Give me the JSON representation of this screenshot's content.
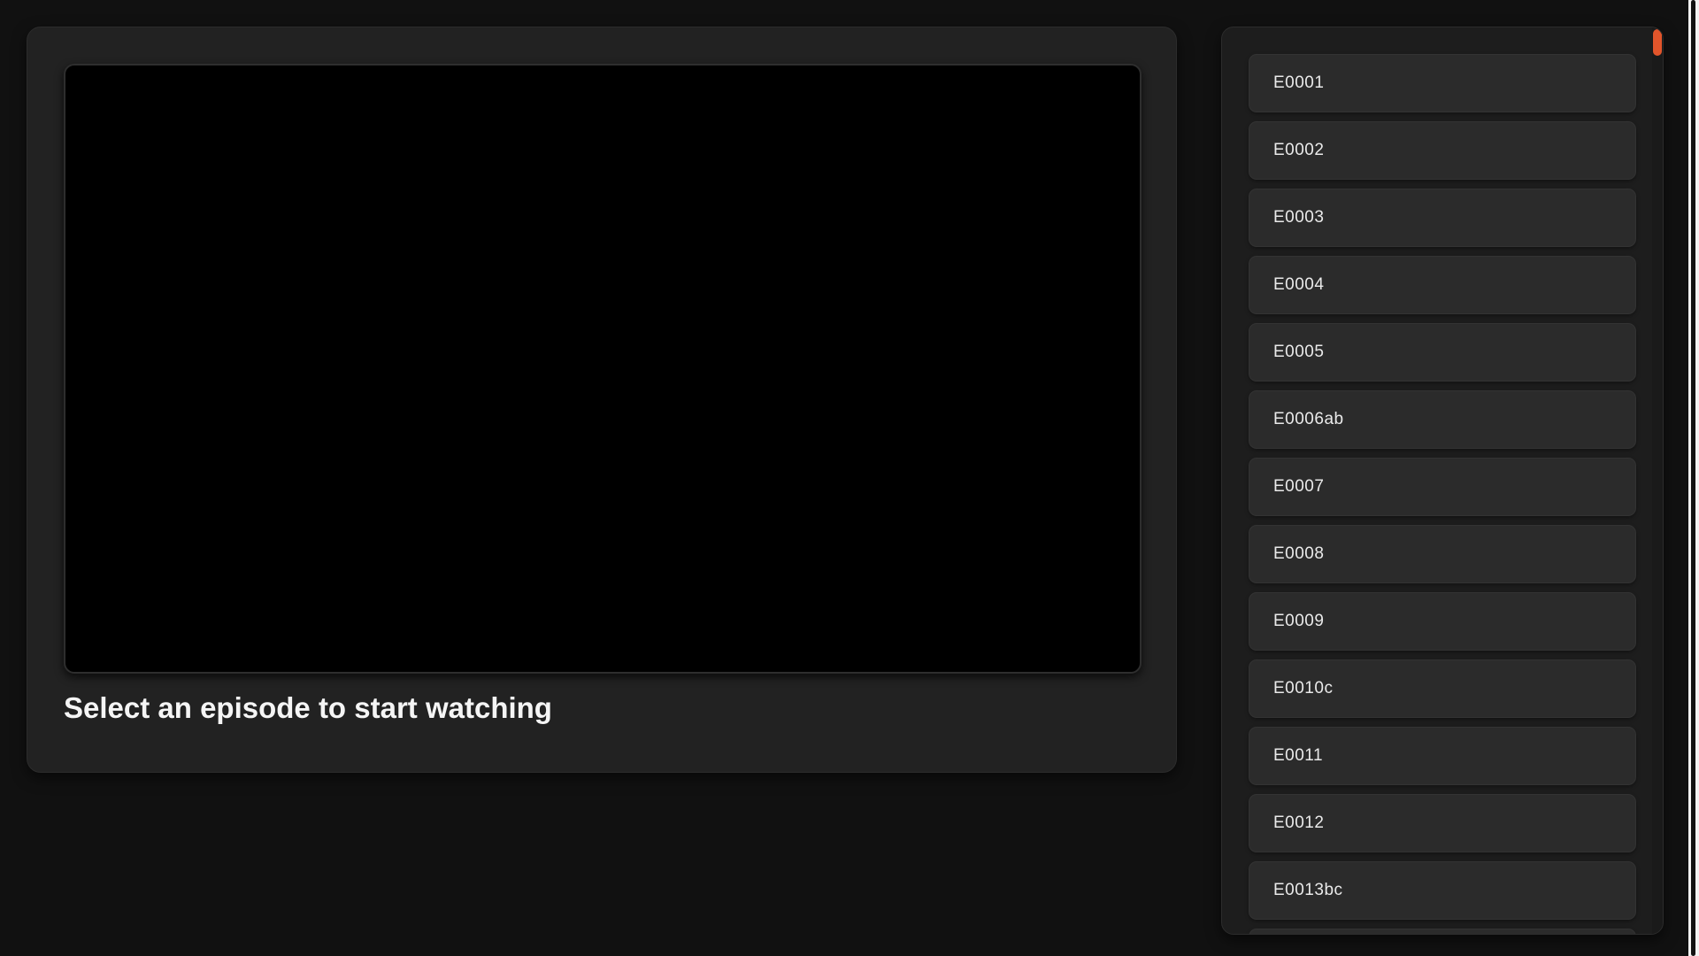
{
  "player": {
    "status_text": "Select an episode to start watching"
  },
  "episodes": [
    {
      "label": "E0001"
    },
    {
      "label": "E0002"
    },
    {
      "label": "E0003"
    },
    {
      "label": "E0004"
    },
    {
      "label": "E0005"
    },
    {
      "label": "E0006ab"
    },
    {
      "label": "E0007"
    },
    {
      "label": "E0008"
    },
    {
      "label": "E0009"
    },
    {
      "label": "E0010c"
    },
    {
      "label": "E0011"
    },
    {
      "label": "E0012"
    },
    {
      "label": "E0013bc"
    },
    {
      "label": ""
    }
  ],
  "colors": {
    "accent": "#e2552b",
    "background": "#111111",
    "card": "#222222",
    "item": "#2b2b2b"
  }
}
